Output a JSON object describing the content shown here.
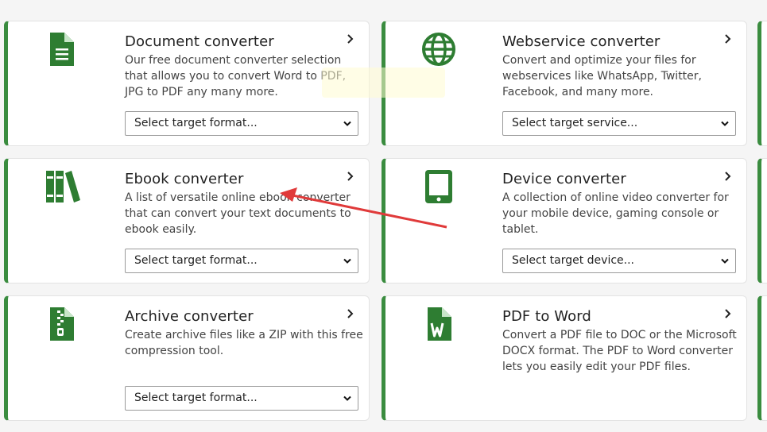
{
  "cards": [
    {
      "title": "Document converter",
      "description": "Our free document converter selection that allows you to convert Word to PDF, JPG to PDF any many more.",
      "select": "Select target format...",
      "icon": "document-icon"
    },
    {
      "title": "Webservice converter",
      "description": "Convert and optimize your files for webservices like WhatsApp, Twitter, Facebook, and many more.",
      "select": "Select target service...",
      "icon": "globe-icon"
    },
    {
      "title": "Ebook converter",
      "description": "A list of versatile online ebook converter that can convert your text documents to ebook easily.",
      "select": "Select target format...",
      "icon": "books-icon"
    },
    {
      "title": "Device converter",
      "description": "A collection of online video converter for your mobile device, gaming console or tablet.",
      "select": "Select target device...",
      "icon": "tablet-icon"
    },
    {
      "title": "Archive converter",
      "description": "Create archive files like a ZIP with this free compression tool.",
      "select": "Select target format...",
      "icon": "zip-file-icon"
    },
    {
      "title": "PDF to Word",
      "description": "Convert a PDF file to DOC or the Microsoft DOCX format. The PDF to Word converter lets you easily edit your PDF files.",
      "icon": "word-file-icon"
    }
  ],
  "watermark": "",
  "colors": {
    "accent": "#3a8c3f",
    "arrow": "#e03a3a"
  }
}
